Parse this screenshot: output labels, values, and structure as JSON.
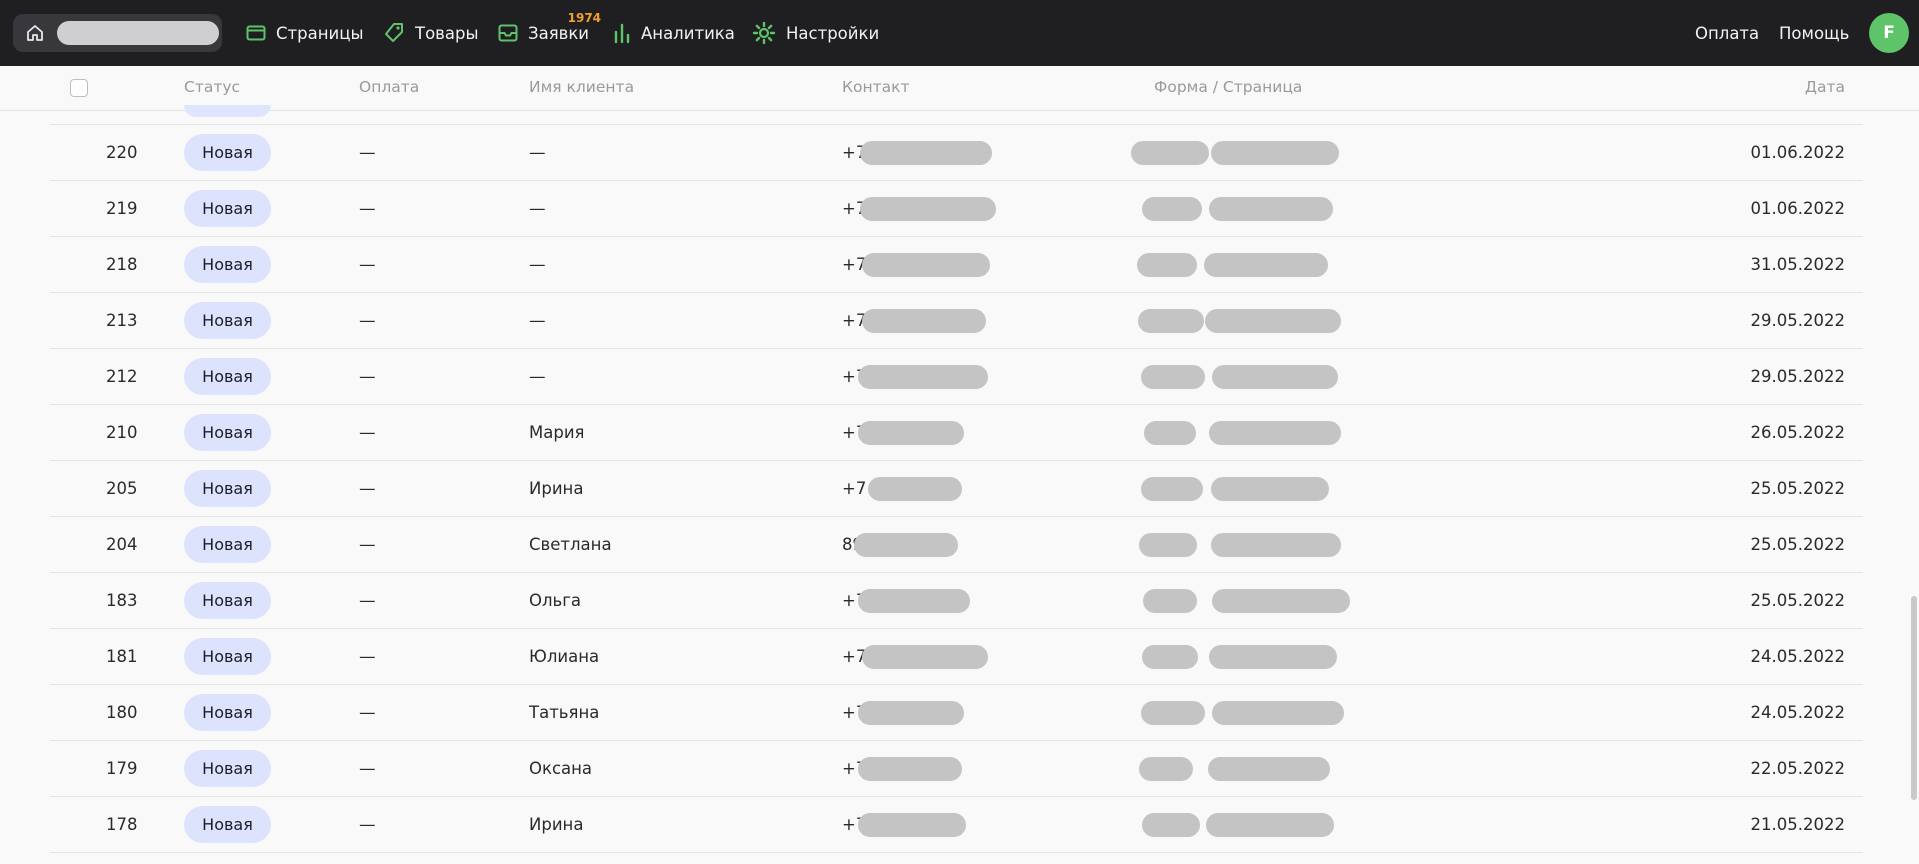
{
  "nav": {
    "items": [
      {
        "label": "Страницы",
        "icon": "pages-icon"
      },
      {
        "label": "Товары",
        "icon": "tag-icon"
      },
      {
        "label": "Заявки",
        "icon": "inbox-icon",
        "badge": "1974"
      },
      {
        "label": "Аналитика",
        "icon": "analytics-icon"
      },
      {
        "label": "Настройки",
        "icon": "gear-icon"
      }
    ],
    "payment": "Оплата",
    "help": "Помощь",
    "avatar_letter": "F",
    "accent": "#5fc36a",
    "badge_color": "#f0a12b"
  },
  "table": {
    "headers": {
      "status": "Статус",
      "payment": "Оплата",
      "client": "Имя клиента",
      "contact": "Контакт",
      "form": "Форма / Страница",
      "date": "Дата"
    },
    "rows": [
      {
        "id": "220",
        "status": "Новая",
        "payment": "—",
        "client": "—",
        "contact": "+7",
        "date": "01.06.2022"
      },
      {
        "id": "219",
        "status": "Новая",
        "payment": "—",
        "client": "—",
        "contact": "+7",
        "date": "01.06.2022"
      },
      {
        "id": "218",
        "status": "Новая",
        "payment": "—",
        "client": "—",
        "contact": "+7",
        "date": "31.05.2022"
      },
      {
        "id": "213",
        "status": "Новая",
        "payment": "—",
        "client": "—",
        "contact": "+7",
        "date": "29.05.2022"
      },
      {
        "id": "212",
        "status": "Новая",
        "payment": "—",
        "client": "—",
        "contact": "+7",
        "date": "29.05.2022"
      },
      {
        "id": "210",
        "status": "Новая",
        "payment": "—",
        "client": "Мария",
        "contact": "+7",
        "date": "26.05.2022"
      },
      {
        "id": "205",
        "status": "Новая",
        "payment": "—",
        "client": "Ирина",
        "contact": "+7",
        "date": "25.05.2022"
      },
      {
        "id": "204",
        "status": "Новая",
        "payment": "—",
        "client": "Светлана",
        "contact": "89",
        "date": "25.05.2022"
      },
      {
        "id": "183",
        "status": "Новая",
        "payment": "—",
        "client": "Ольга",
        "contact": "+7",
        "date": "25.05.2022"
      },
      {
        "id": "181",
        "status": "Новая",
        "payment": "—",
        "client": "Юлиана",
        "contact": "+7",
        "date": "24.05.2022"
      },
      {
        "id": "180",
        "status": "Новая",
        "payment": "—",
        "client": "Татьяна",
        "contact": "+7",
        "date": "24.05.2022"
      },
      {
        "id": "179",
        "status": "Новая",
        "payment": "—",
        "client": "Оксана",
        "contact": "+7",
        "date": "22.05.2022"
      },
      {
        "id": "178",
        "status": "Новая",
        "payment": "—",
        "client": "Ирина",
        "contact": "+7",
        "date": "21.05.2022"
      }
    ]
  }
}
